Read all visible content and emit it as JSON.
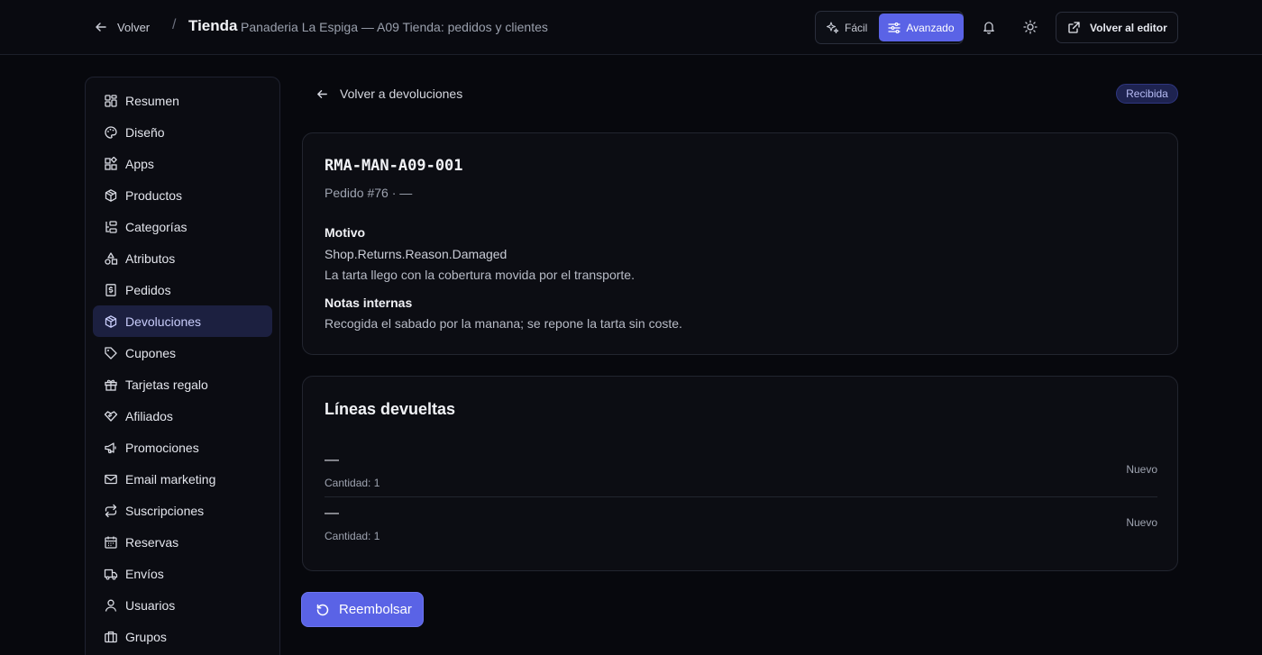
{
  "topbar": {
    "back_label": "Volver",
    "separator": "/",
    "title": "Tienda",
    "subtitle": "Panaderia La Espiga — A09 Tienda: pedidos y clientes",
    "mode_easy": "Fácil",
    "mode_advanced": "Avanzado",
    "active_mode": "Avanzado",
    "editor_label": "Volver al editor"
  },
  "sidebar": {
    "items": [
      {
        "label": "Resumen",
        "icon": "grid-icon"
      },
      {
        "label": "Diseño",
        "icon": "palette-icon"
      },
      {
        "label": "Apps",
        "icon": "apps-icon"
      },
      {
        "label": "Productos",
        "icon": "box-icon"
      },
      {
        "label": "Categorías",
        "icon": "category-icon"
      },
      {
        "label": "Atributos",
        "icon": "shapes-icon"
      },
      {
        "label": "Pedidos",
        "icon": "receipt-icon"
      },
      {
        "label": "Devoluciones",
        "icon": "box-icon"
      },
      {
        "label": "Cupones",
        "icon": "tag-icon"
      },
      {
        "label": "Tarjetas regalo",
        "icon": "gift-icon"
      },
      {
        "label": "Afiliados",
        "icon": "handshake-icon"
      },
      {
        "label": "Promociones",
        "icon": "megaphone-icon"
      },
      {
        "label": "Email marketing",
        "icon": "mail-icon"
      },
      {
        "label": "Suscripciones",
        "icon": "repeat-icon"
      },
      {
        "label": "Reservas",
        "icon": "calendar-icon"
      },
      {
        "label": "Envíos",
        "icon": "truck-icon"
      },
      {
        "label": "Usuarios",
        "icon": "user-icon"
      },
      {
        "label": "Grupos",
        "icon": "briefcase-icon"
      }
    ],
    "active": "Devoluciones"
  },
  "main": {
    "back_label": "Volver a devoluciones",
    "status_badge": "Recibida",
    "rma": {
      "code": "RMA-MAN-A09-001",
      "order_ref": "Pedido #76 · —",
      "reason_label": "Motivo",
      "reason_code": "Shop.Returns.Reason.Damaged",
      "reason_text": "La tarta llego con la cobertura movida por el transporte.",
      "notes_label": "Notas internas",
      "notes_text": "Recogida el sabado por la manana; se repone la tarta sin coste."
    },
    "lines": {
      "title": "Líneas devueltas",
      "items": [
        {
          "name": "—",
          "qty": "Cantidad: 1",
          "condition": "Nuevo"
        },
        {
          "name": "—",
          "qty": "Cantidad: 1",
          "condition": "Nuevo"
        }
      ]
    },
    "refund_label": "Reembolsar"
  },
  "colors": {
    "background": "#07080d",
    "accent": "#5a63e6",
    "active_nav": "#1c2040",
    "badge_bg": "#1e2350"
  }
}
